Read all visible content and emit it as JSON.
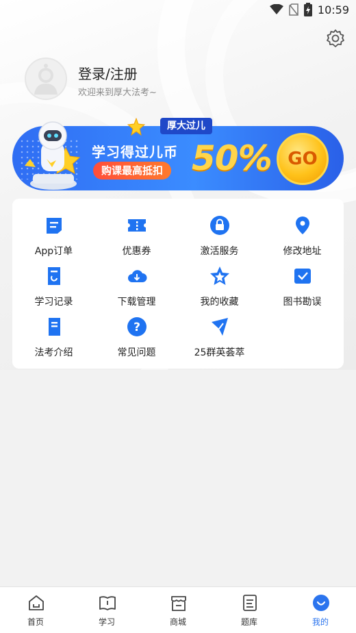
{
  "status_bar": {
    "time": "10:59"
  },
  "profile": {
    "title": "登录/注册",
    "subtitle": "欢迎来到厚大法考~"
  },
  "banner": {
    "tag": "厚大过儿",
    "title": "学习得过儿币",
    "pill": "购课最高抵扣",
    "percent": "50%",
    "coin": "GO"
  },
  "grid": {
    "items": [
      {
        "label": "App订单",
        "icon": "order-icon"
      },
      {
        "label": "优惠券",
        "icon": "coupon-icon"
      },
      {
        "label": "激活服务",
        "icon": "lock-icon"
      },
      {
        "label": "修改地址",
        "icon": "location-icon"
      },
      {
        "label": "学习记录",
        "icon": "study-record-icon"
      },
      {
        "label": "下载管理",
        "icon": "cloud-download-icon"
      },
      {
        "label": "我的收藏",
        "icon": "star-icon"
      },
      {
        "label": "图书勘误",
        "icon": "mail-check-icon"
      },
      {
        "label": "法考介绍",
        "icon": "book-icon"
      },
      {
        "label": "常见问题",
        "icon": "question-icon"
      },
      {
        "label": "25群英荟萃",
        "icon": "paper-plane-icon"
      }
    ]
  },
  "tabbar": {
    "items": [
      {
        "label": "首页",
        "icon": "home-icon"
      },
      {
        "label": "学习",
        "icon": "study-book-icon"
      },
      {
        "label": "商城",
        "icon": "store-icon"
      },
      {
        "label": "题库",
        "icon": "question-bank-icon"
      },
      {
        "label": "我的",
        "icon": "profile-smile-icon",
        "active": true
      }
    ]
  },
  "colors": {
    "accent": "#2b74ee",
    "icon_blue": "#1f73f1",
    "background": "#f2f2f2"
  }
}
